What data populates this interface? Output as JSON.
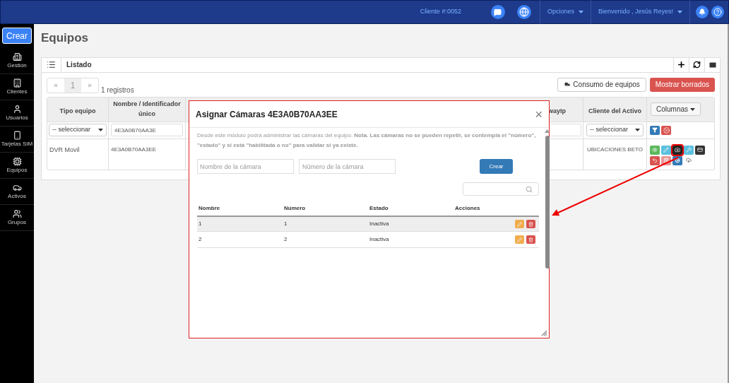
{
  "topbar": {
    "client": "Cliente #:0052",
    "menus": [
      {
        "label": "Opciones"
      },
      {
        "label": "Bienvenido , Jesús Reyes!"
      }
    ]
  },
  "sidebar": {
    "create_button": "Crear",
    "items": [
      {
        "label": "Gestión"
      },
      {
        "label": "Clientes"
      },
      {
        "label": "Usuarios"
      },
      {
        "label": "Tarjetas SIM"
      },
      {
        "label": "Equipos"
      },
      {
        "label": "Activos"
      },
      {
        "label": "Grupos"
      }
    ]
  },
  "page_title": "Equipos",
  "panel": {
    "title": "Listado"
  },
  "pagination": {
    "prev": "«",
    "pages": [
      {
        "label": "1",
        "selected": true
      }
    ],
    "next": "»",
    "count": "1 registros"
  },
  "toolbar": {
    "buttons": [
      {
        "label": "Consumo de equipos",
        "kind": "default"
      },
      {
        "label": "Mostrar borrados",
        "kind": "danger"
      }
    ]
  },
  "table": {
    "columns": [
      "Tipo equipo",
      "Nombre / Identificador único",
      "wayIp",
      "Cliente del Activo"
    ],
    "columns_button": "Columnas",
    "filters": {
      "type": "-- seleccionar",
      "name": "4E3A0B70AA3E",
      "client": "-- seleccionar"
    },
    "rows": [
      {
        "type": "DVR Movil",
        "name": "4E3A0B70AA3EE",
        "client": "UBICACIONES BETO",
        "actions": [
          {
            "kind": "view",
            "highlighted": false,
            "disabled": false
          },
          {
            "kind": "edit",
            "highlighted": false,
            "disabled": false
          },
          {
            "kind": "camera",
            "highlighted": true,
            "disabled": false
          },
          {
            "kind": "tools",
            "highlighted": false,
            "disabled": false
          },
          {
            "kind": "card",
            "highlighted": false,
            "disabled": false
          },
          {
            "kind": "undo",
            "highlighted": false,
            "disabled": false
          },
          {
            "kind": "delete",
            "highlighted": false,
            "disabled": true
          },
          {
            "kind": "settings",
            "highlighted": false,
            "disabled": false
          },
          {
            "kind": "upload",
            "highlighted": false,
            "disabled": false
          }
        ]
      }
    ]
  },
  "modal": {
    "title": "Asignar Cámaras 4E3A0B70AA3EE",
    "close": "×",
    "intro": "Desde este módulo podrá administrar las cámaras del equipo. **Nota. Las cámaras no se pueden repetir, se contempla el \"número\", \"estado\" y si está \"habilitada o no\" para validar si ya existe.**",
    "name_placeholder": "Nombre de la cámara",
    "number_placeholder": "Número de la cámara",
    "create_button": "Crear",
    "columns": [
      "Nombre",
      "Número",
      "Estado",
      "Acciones"
    ],
    "rows": [
      {
        "cells": [
          "1",
          "1",
          "Inactiva"
        ],
        "selected": true
      },
      {
        "cells": [
          "2",
          "2",
          "Inactiva"
        ],
        "selected": false
      }
    ]
  }
}
